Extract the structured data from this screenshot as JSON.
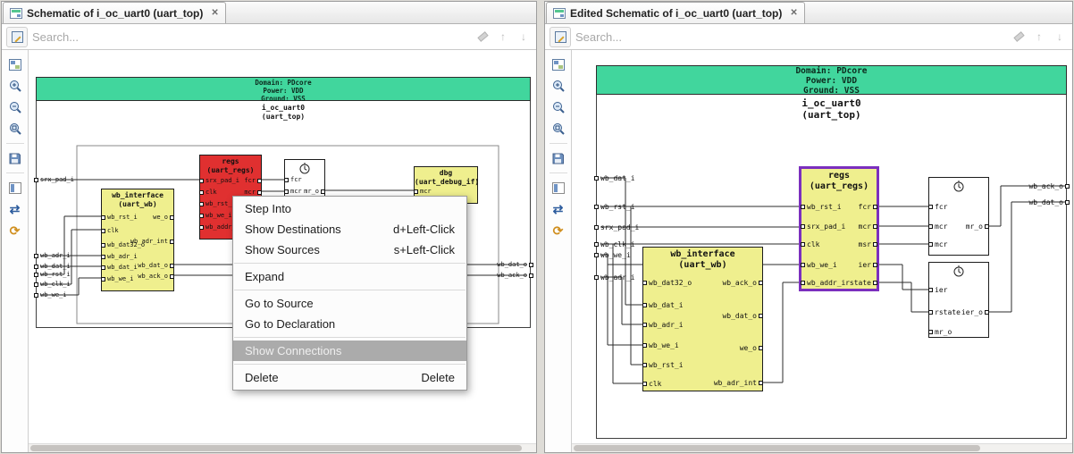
{
  "icons": {
    "close": "✕",
    "refresh": "⟳",
    "swap_arrows": "⇄",
    "search_prev": "↑",
    "search_next": "↓"
  },
  "colors": {
    "banner_green": "#41d69d",
    "block_yellow": "#efef8e",
    "block_red": "#e03030",
    "selection_purple": "#7b2fbe",
    "menu_highlight": "#ababab"
  },
  "left_panel": {
    "tab_label": "Schematic of i_oc_uart0 (uart_top)",
    "search_placeholder": "Search...",
    "banner": {
      "domain": "Domain: PDcore",
      "power": "Power: VDD",
      "ground": "Ground: VSS"
    },
    "instance_name": "i_oc_uart0",
    "instance_type": "(uart_top)",
    "input_pins": [
      "srx_pad_i",
      "wb_adr_i",
      "wb_dat_i",
      "wb_rst_i",
      "wb_clk_i",
      "wb_we_i"
    ],
    "output_pins": [
      "wb_dat_o",
      "wb_ack_o"
    ],
    "blocks": {
      "regs": {
        "name": "regs",
        "type": "(uart_regs)",
        "inputs": [
          "srx_pad_i",
          "clk",
          "wb_rst_i",
          "wb_we_i",
          "wb_addr_i"
        ],
        "outputs": [
          "fcr",
          "mcr"
        ]
      },
      "clocked1": {
        "inputs": [
          "fcr",
          "mcr"
        ],
        "outputs": [
          "mr_o"
        ]
      },
      "dbg": {
        "name": "dbg",
        "type": "(uart_debug_if)",
        "inputs": [
          "mcr"
        ]
      },
      "wb_interface": {
        "name": "wb_interface",
        "type": "(uart_wb)",
        "inputs": [
          "wb_rst_i",
          "clk",
          "wb_dat32_o",
          "wb_adr_i",
          "wb_dat_i",
          "wb_we_i"
        ],
        "outputs": [
          "we_o",
          "wb_adr_int",
          "wb_dat_o",
          "wb_ack_o"
        ]
      }
    },
    "context_menu": {
      "highlighted": "Show Connections",
      "items": [
        {
          "label": "Step Into",
          "shortcut": ""
        },
        {
          "label": "Show Destinations",
          "shortcut": "d+Left-Click"
        },
        {
          "label": "Show Sources",
          "shortcut": "s+Left-Click"
        },
        {
          "label": "Expand",
          "shortcut": ""
        },
        {
          "label": "Go to Source",
          "shortcut": ""
        },
        {
          "label": "Go to Declaration",
          "shortcut": ""
        },
        {
          "label": "Show Connections",
          "shortcut": ""
        },
        {
          "label": "Delete",
          "shortcut": "Delete"
        }
      ]
    }
  },
  "right_panel": {
    "tab_label": "Edited Schematic of i_oc_uart0 (uart_top)",
    "search_placeholder": "Search...",
    "banner": {
      "domain": "Domain: PDcore",
      "power": "Power: VDD",
      "ground": "Ground: VSS"
    },
    "instance_name": "i_oc_uart0",
    "instance_type": "(uart_top)",
    "input_pins": [
      "wb_dat_i",
      "wb_rst_i",
      "srx_pad_i",
      "wb_clk_i",
      "wb_we_i",
      "wb_adr_i"
    ],
    "output_pins": [
      "wb_ack_o",
      "wb_dat_o"
    ],
    "blocks": {
      "regs": {
        "name": "regs",
        "type": "(uart_regs)",
        "inputs": [
          "wb_rst_i",
          "srx_pad_i",
          "clk",
          "wb_we_i",
          "wb_addr_i"
        ],
        "outputs": [
          "fcr",
          "mcr",
          "msr",
          "ier",
          "rstate"
        ]
      },
      "clocked1": {
        "inputs": [
          "fcr",
          "mcr",
          "mcr"
        ],
        "outputs": [
          "mr_o"
        ]
      },
      "clocked2": {
        "inputs": [
          "ier",
          "rstate",
          "mr_o"
        ],
        "outputs": [
          "ier_o"
        ]
      },
      "wb_interface": {
        "name": "wb_interface",
        "type": "(uart_wb)",
        "inputs": [
          "wb_dat32_o",
          "wb_dat_i",
          "wb_adr_i",
          "wb_we_i",
          "wb_rst_i",
          "clk"
        ],
        "outputs": [
          "wb_ack_o",
          "wb_dat_o",
          "we_o",
          "wb_adr_int"
        ]
      }
    }
  }
}
